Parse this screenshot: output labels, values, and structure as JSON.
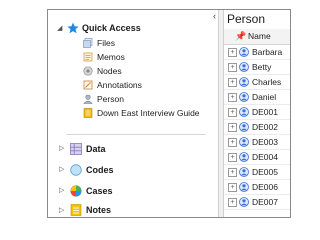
{
  "navigation": {
    "quick_access": {
      "label": "Quick Access",
      "items": [
        {
          "label": "Files",
          "icon": "files-icon"
        },
        {
          "label": "Memos",
          "icon": "memos-icon"
        },
        {
          "label": "Nodes",
          "icon": "nodes-icon"
        },
        {
          "label": "Annotations",
          "icon": "annotations-icon"
        },
        {
          "label": "Person",
          "icon": "person-icon"
        },
        {
          "label": "Down East Interview Guide",
          "icon": "document-icon"
        }
      ]
    },
    "sections": [
      {
        "label": "Data",
        "icon": "data-icon"
      },
      {
        "label": "Codes",
        "icon": "codes-icon"
      },
      {
        "label": "Cases",
        "icon": "cases-icon"
      },
      {
        "label": "Notes",
        "icon": "notes-icon"
      }
    ]
  },
  "list_view": {
    "title": "Person",
    "column_header": "Name",
    "rows": [
      "Barbara",
      "Betty",
      "Charles",
      "Daniel",
      "DE001",
      "DE002",
      "DE003",
      "DE004",
      "DE005",
      "DE006",
      "DE007"
    ]
  },
  "colors": {
    "star": "#1e88e5",
    "files": "#c7d7ef",
    "memos": "#f2b24a",
    "nodes": "#c0c0c0",
    "annotations": "#f2b24a",
    "person": "#b0b8c8",
    "document": "#f5b400",
    "data": "#b0a6d6",
    "codes": "#9ed0f2",
    "notes": "#f5c400",
    "case_person": "#3a6fd8"
  }
}
